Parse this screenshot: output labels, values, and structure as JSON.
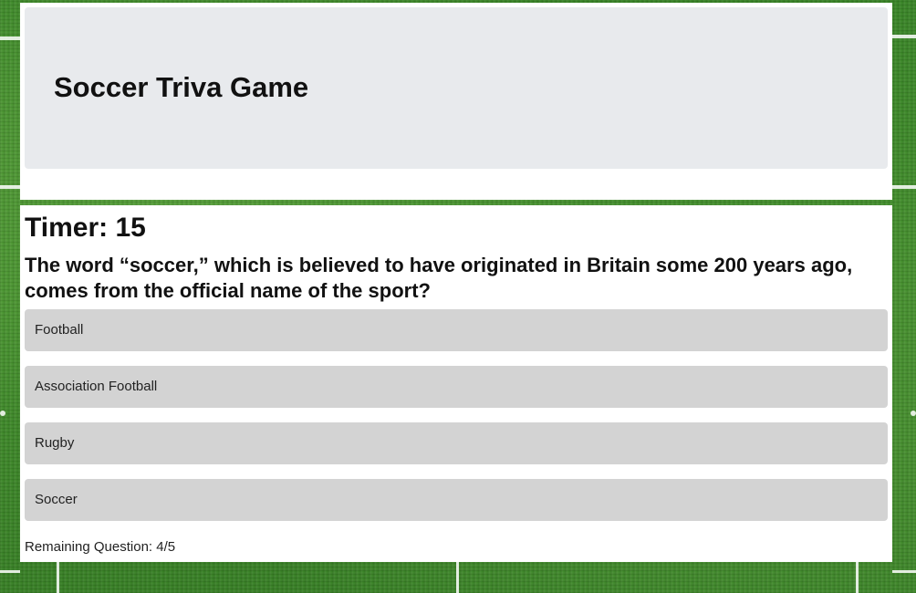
{
  "header": {
    "title": "Soccer Triva Game"
  },
  "quiz": {
    "timer_text": "Timer: 15",
    "question": "The word “soccer,” which is believed to have originated in Britain some 200 years ago, comes from the official name of the sport?",
    "answers": [
      "Football",
      "Association Football",
      "Rugby",
      "Soccer"
    ],
    "remaining_text": "Remaining Question: 4/5"
  },
  "colors": {
    "grass": "#3f8a2c",
    "header_bg": "#e8eaed",
    "answer_bg": "#d3d3d3",
    "card_bg": "#ffffff"
  }
}
